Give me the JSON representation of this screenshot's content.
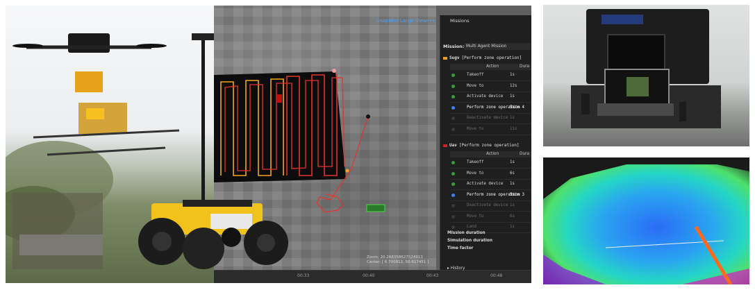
{
  "map": {
    "snapshot_label": "Snapshot",
    "large_view_label": "Large View",
    "zoom_readout": "Zoom: 20.268358627524913",
    "center_readout": "Center: [ 6.700812, 50.617451 ]",
    "timeline_ticks": [
      "00:33",
      "00:40",
      "00:43",
      "00:48"
    ]
  },
  "missions_panel": {
    "title": "Missions",
    "mission_label": "Mission:",
    "mission_value": "Multi Agent Mission",
    "groups": [
      {
        "name": "Sugv",
        "op": "[Perform zone operation]",
        "color": "#e8a21c",
        "head_action": "Action",
        "head_duration": "Dura",
        "rows": [
          {
            "action": "Takeoff",
            "duration": "1s",
            "state": "done"
          },
          {
            "action": "Move to",
            "duration": "12s",
            "state": "done"
          },
          {
            "action": "Activate device",
            "duration": "1s",
            "state": "done"
          },
          {
            "action": "Perform zone operation",
            "duration": "5min 4",
            "state": "active"
          },
          {
            "action": "Deactivate device",
            "duration": "1s",
            "state": "pending"
          },
          {
            "action": "Move to",
            "duration": "11s",
            "state": "pending"
          }
        ]
      },
      {
        "name": "Uav",
        "op": "[Perform zone operation]",
        "color": "#c8242a",
        "head_action": "Action",
        "head_duration": "Dura",
        "rows": [
          {
            "action": "Takeoff",
            "duration": "1s",
            "state": "done"
          },
          {
            "action": "Move to",
            "duration": "6s",
            "state": "done"
          },
          {
            "action": "Activate device",
            "duration": "1s",
            "state": "done"
          },
          {
            "action": "Perform zone operation",
            "duration": "5min 3",
            "state": "active"
          },
          {
            "action": "Deactivate device",
            "duration": "1s",
            "state": "pending"
          },
          {
            "action": "Move to",
            "duration": "6s",
            "state": "pending"
          },
          {
            "action": "Land",
            "duration": "1s",
            "state": "pending"
          }
        ]
      }
    ],
    "footer": {
      "mission_duration": "Mission duration",
      "simulation_duration": "Simulation duration",
      "time_factor": "Time factor",
      "history": "▸ History"
    }
  },
  "colors": {
    "done": "#3a9d3a",
    "active": "#3b82f6",
    "pending": "#3a3a3a",
    "path_red": "#e3342f",
    "path_orange": "#f5a623"
  }
}
